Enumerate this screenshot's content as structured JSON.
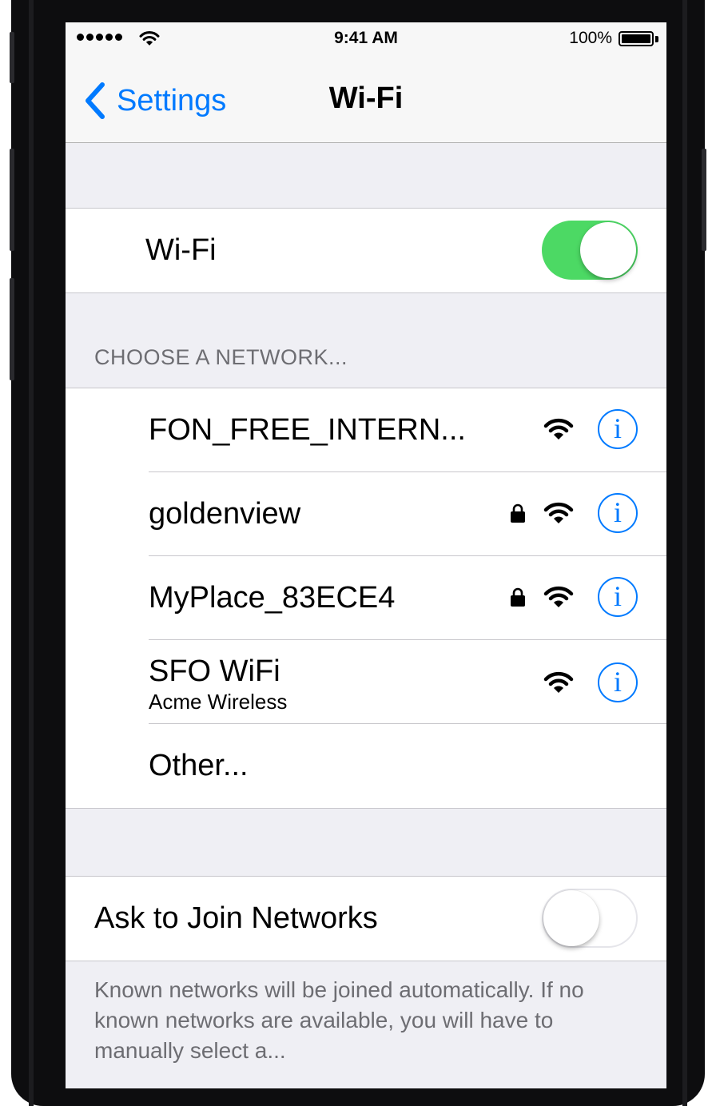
{
  "status_bar": {
    "time": "9:41 AM",
    "battery_percent": "100%",
    "signal_bars": 5
  },
  "nav": {
    "back_label": "Settings",
    "title": "Wi-Fi"
  },
  "wifi_toggle": {
    "label": "Wi-Fi",
    "state": "on"
  },
  "networks_header": "CHOOSE A NETWORK...",
  "networks": [
    {
      "name": "FON_FREE_INTERN...",
      "secured": false
    },
    {
      "name": "goldenview",
      "secured": true
    },
    {
      "name": "MyPlace_83ECE4",
      "secured": true
    },
    {
      "name": "SFO WiFi",
      "subtitle": "Acme Wireless",
      "secured": false
    }
  ],
  "other_label": "Other...",
  "ask_to_join": {
    "label": "Ask to Join Networks",
    "state": "off"
  },
  "footer": "Known networks will be joined automatically. If no known networks are available, you will have to manually select a...",
  "colors": {
    "accent": "#007aff",
    "toggle_on": "#4cd964",
    "background": "#efeff4",
    "secondary_text": "#6d6d72"
  },
  "icons": [
    "signal-dots",
    "wifi-icon",
    "battery-icon",
    "back-chevron-icon",
    "lock-icon",
    "info-icon"
  ]
}
